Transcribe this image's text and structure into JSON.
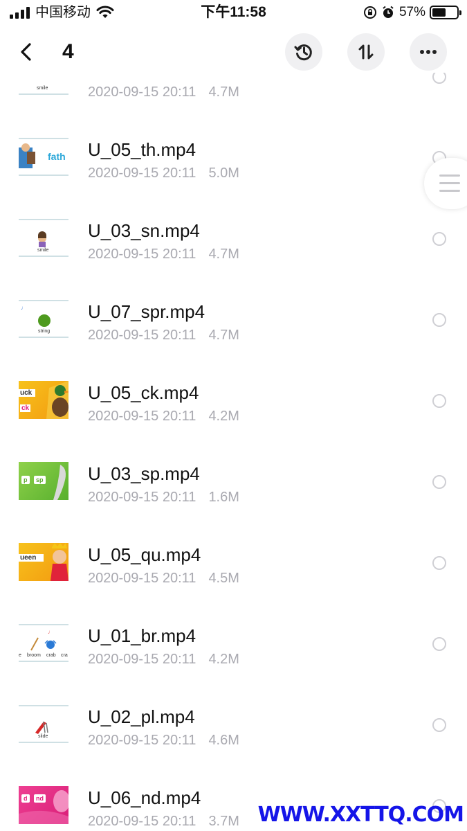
{
  "status_bar": {
    "carrier": "中国移动",
    "time": "下午11:58",
    "battery": "57%",
    "battery_level": 0.57
  },
  "nav": {
    "title": "4"
  },
  "files": [
    {
      "name": "",
      "date": "2020-09-15 20:11",
      "size": "4.7M",
      "thumb_caption": "smile"
    },
    {
      "name": "U_05_th.mp4",
      "date": "2020-09-15 20:11",
      "size": "5.0M",
      "thumb_caption": "fath"
    },
    {
      "name": "U_03_sn.mp4",
      "date": "2020-09-15 20:11",
      "size": "4.7M",
      "thumb_caption": "smile"
    },
    {
      "name": "U_07_spr.mp4",
      "date": "2020-09-15 20:11",
      "size": "4.7M",
      "thumb_caption": "string"
    },
    {
      "name": "U_05_ck.mp4",
      "date": "2020-09-15 20:11",
      "size": "4.2M",
      "thumb_caption": "uck",
      "thumb_caption2": "ck"
    },
    {
      "name": "U_03_sp.mp4",
      "date": "2020-09-15 20:11",
      "size": "1.6M",
      "thumb_caption": "p",
      "thumb_caption2": "sp"
    },
    {
      "name": "U_05_qu.mp4",
      "date": "2020-09-15 20:11",
      "size": "4.5M",
      "thumb_caption": "ueen"
    },
    {
      "name": "U_01_br.mp4",
      "date": "2020-09-15 20:11",
      "size": "4.2M",
      "thumb_caption": "e",
      "thumb_caption2": "broom",
      "thumb_caption3": "crab",
      "thumb_caption4": "cra"
    },
    {
      "name": "U_02_pl.mp4",
      "date": "2020-09-15 20:11",
      "size": "4.6M",
      "thumb_caption": "slide"
    },
    {
      "name": "U_06_nd.mp4",
      "date": "2020-09-15 20:11",
      "size": "3.7M",
      "thumb_caption": "d",
      "thumb_caption2": "nd"
    }
  ],
  "watermark": "WWW.XXTTQ.COM",
  "colors": {
    "meta_text": "#a9a9b0",
    "button_bg": "#f0f0f2",
    "watermark": "#1515e8"
  },
  "icons": [
    "back-chevron",
    "history",
    "sort",
    "more"
  ]
}
